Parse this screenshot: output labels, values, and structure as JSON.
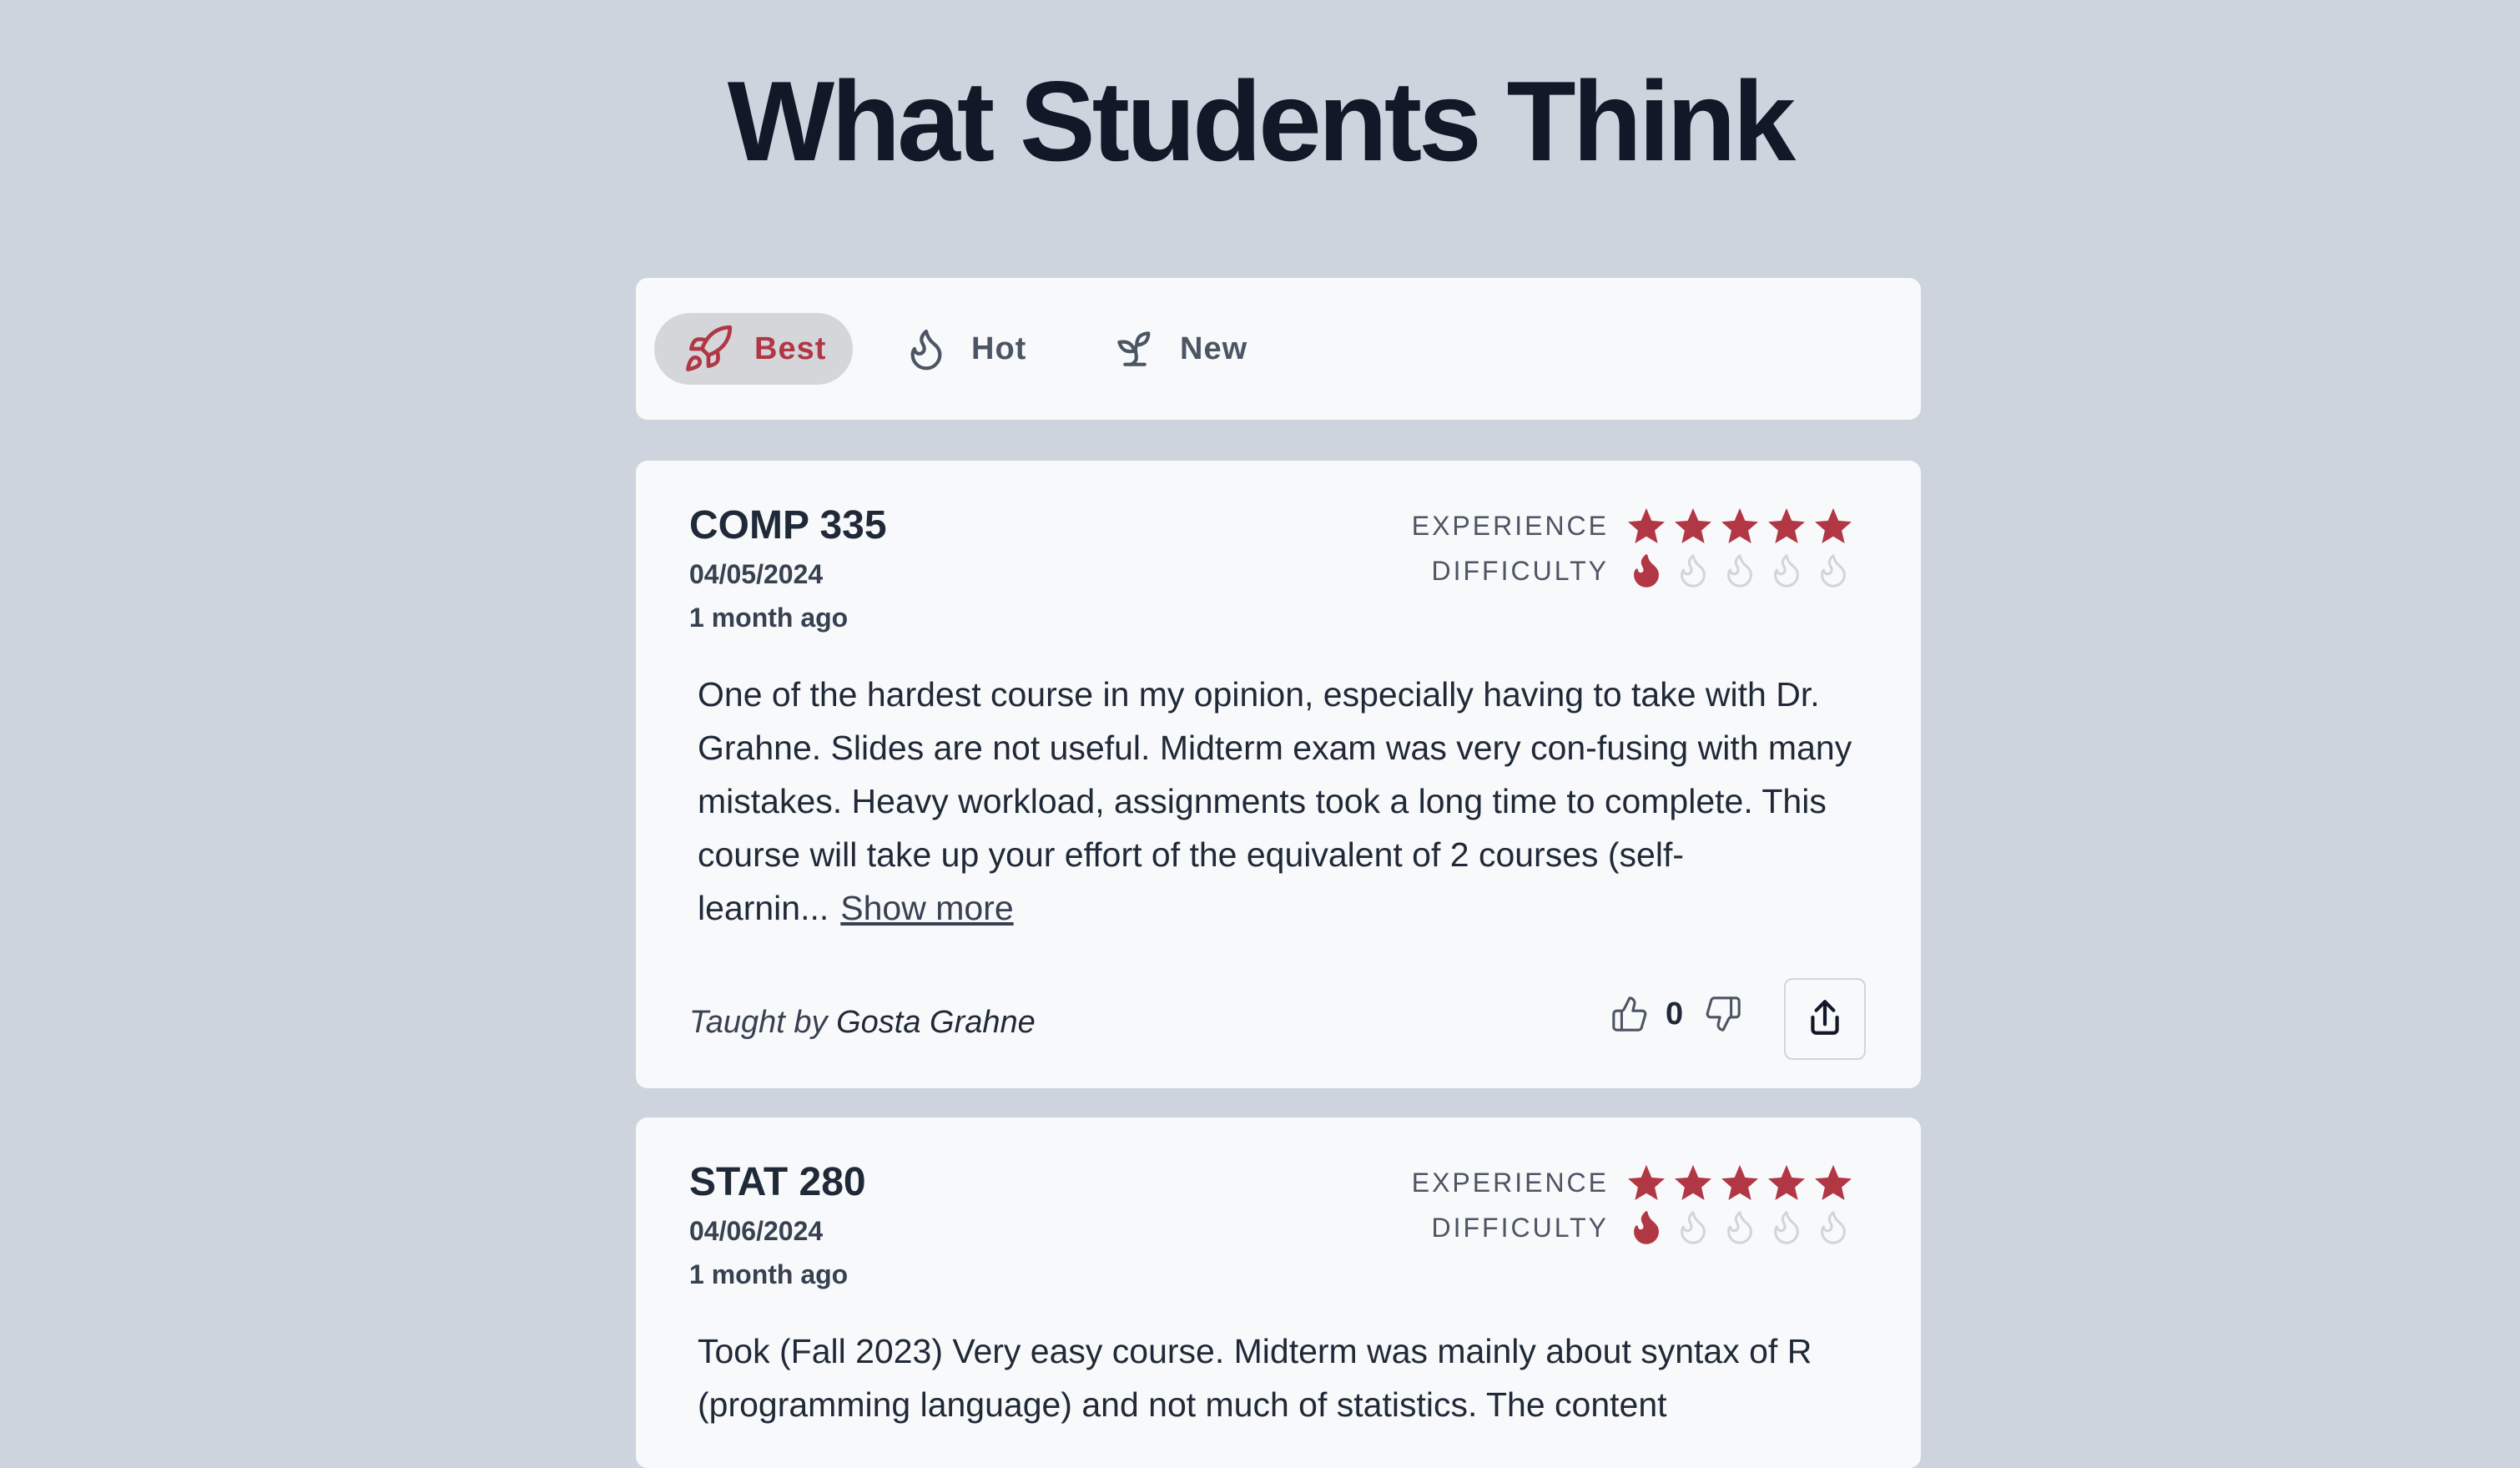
{
  "page": {
    "title": "What Students Think"
  },
  "sort_tabs": [
    {
      "label": "Best",
      "icon": "rocket-icon",
      "active": true
    },
    {
      "label": "Hot",
      "icon": "flame-icon",
      "active": false
    },
    {
      "label": "New",
      "icon": "sprout-icon",
      "active": false
    }
  ],
  "labels": {
    "experience": "EXPERIENCE",
    "difficulty": "DIFFICULTY",
    "taught_by": "Taught by",
    "show_more": "Show more"
  },
  "reviews": [
    {
      "course": "COMP 335",
      "date": "04/05/2024",
      "ago": "1 month ago",
      "experience": 5,
      "difficulty": 1,
      "body": "One of the hardest course in my opinion, especially having to take with Dr. Grahne. Slides are not useful. Midterm exam was very con-fusing with many mistakes. Heavy workload, assignments took a long time to complete. This course will take up your effort of the equivalent of 2 courses (self-learnin...",
      "professor": "Gosta Grahne",
      "votes": "0"
    },
    {
      "course": "STAT 280",
      "date": "04/06/2024",
      "ago": "1 month ago",
      "experience": 5,
      "difficulty": 1,
      "body": "Took (Fall 2023) Very easy course. Midterm was mainly about syntax of R (programming language) and not much of statistics. The content"
    }
  ],
  "colors": {
    "background": "#cdd4de",
    "card": "#f8f9fb",
    "accent": "#b23745",
    "inactive_flame": "#d1d5db"
  }
}
